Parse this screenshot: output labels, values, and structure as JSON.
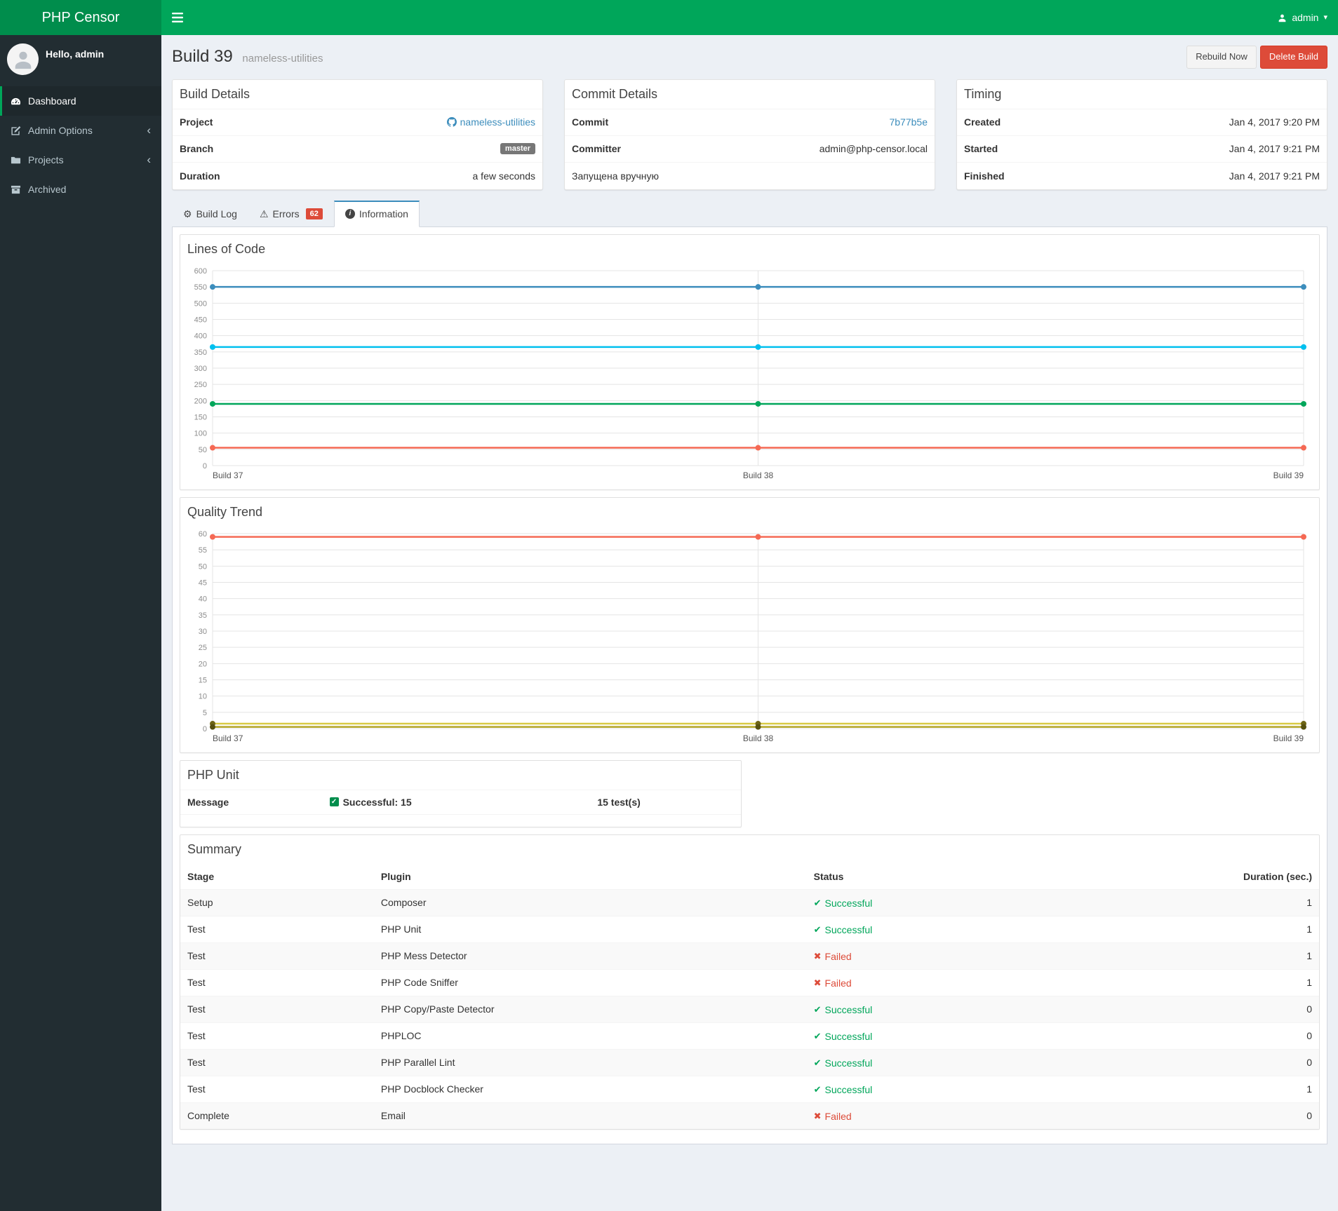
{
  "header": {
    "brand": "PHP Censor",
    "user": "admin"
  },
  "sidebar": {
    "greeting": "Hello, admin",
    "items": [
      {
        "label": "Dashboard"
      },
      {
        "label": "Admin Options"
      },
      {
        "label": "Projects"
      },
      {
        "label": "Archived"
      }
    ]
  },
  "page": {
    "title": "Build 39",
    "subtitle": "nameless-utilities",
    "rebuild_button": "Rebuild Now",
    "delete_button": "Delete Build"
  },
  "build_details": {
    "title": "Build Details",
    "project_label": "Project",
    "project_value": "nameless-utilities",
    "branch_label": "Branch",
    "branch_badge": "master",
    "duration_label": "Duration",
    "duration_value": "a few seconds"
  },
  "commit_details": {
    "title": "Commit Details",
    "commit_label": "Commit",
    "commit_value": "7b77b5e",
    "committer_label": "Committer",
    "committer_value": "admin@php-censor.local",
    "message": "Запущена вручную"
  },
  "timing": {
    "title": "Timing",
    "rows": [
      {
        "label": "Created",
        "value": "Jan 4, 2017 9:20 PM"
      },
      {
        "label": "Started",
        "value": "Jan 4, 2017 9:21 PM"
      },
      {
        "label": "Finished",
        "value": "Jan 4, 2017 9:21 PM"
      }
    ]
  },
  "tabs": {
    "build_log": "Build Log",
    "errors": "Errors",
    "errors_count": "62",
    "information": "Information"
  },
  "php_unit": {
    "title": "PHP Unit",
    "message_header": "Message",
    "status": "Successful: 15",
    "tests": "15 test(s)"
  },
  "summary": {
    "title": "Summary",
    "columns": [
      "Stage",
      "Plugin",
      "Status",
      "Duration (sec.)"
    ],
    "rows": [
      {
        "stage": "Setup",
        "plugin": "Composer",
        "status": "Successful",
        "success": true,
        "duration": "1"
      },
      {
        "stage": "Test",
        "plugin": "PHP Unit",
        "status": "Successful",
        "success": true,
        "duration": "1"
      },
      {
        "stage": "Test",
        "plugin": "PHP Mess Detector",
        "status": "Failed",
        "success": false,
        "duration": "1"
      },
      {
        "stage": "Test",
        "plugin": "PHP Code Sniffer",
        "status": "Failed",
        "success": false,
        "duration": "1"
      },
      {
        "stage": "Test",
        "plugin": "PHP Copy/Paste Detector",
        "status": "Successful",
        "success": true,
        "duration": "0"
      },
      {
        "stage": "Test",
        "plugin": "PHPLOC",
        "status": "Successful",
        "success": true,
        "duration": "0"
      },
      {
        "stage": "Test",
        "plugin": "PHP Parallel Lint",
        "status": "Successful",
        "success": true,
        "duration": "0"
      },
      {
        "stage": "Test",
        "plugin": "PHP Docblock Checker",
        "status": "Successful",
        "success": true,
        "duration": "1"
      },
      {
        "stage": "Complete",
        "plugin": "Email",
        "status": "Failed",
        "success": false,
        "duration": "0"
      }
    ]
  },
  "chart_data": [
    {
      "type": "line",
      "title": "Lines of Code",
      "x": [
        "Build 37",
        "Build 38",
        "Build 39"
      ],
      "series": [
        {
          "color": "#3c8dbc",
          "values": [
            550,
            550,
            550
          ]
        },
        {
          "color": "#00c0ef",
          "values": [
            365,
            365,
            365
          ]
        },
        {
          "color": "#00a65a",
          "values": [
            190,
            190,
            190
          ]
        },
        {
          "color": "#f56954",
          "values": [
            55,
            55,
            55
          ]
        }
      ],
      "ylim": [
        0,
        600
      ],
      "ytick": 50,
      "grid": true,
      "legend": "none"
    },
    {
      "type": "line",
      "title": "Quality Trend",
      "x": [
        "Build 37",
        "Build 38",
        "Build 39"
      ],
      "series": [
        {
          "color": "#f56954",
          "values": [
            59,
            59,
            59
          ]
        },
        {
          "color": "#d8ca43",
          "values": [
            1.5,
            1.5,
            1.5
          ],
          "point_color": "#6f6516"
        },
        {
          "color": "#b3a524",
          "values": [
            0.5,
            0.5,
            0.5
          ],
          "point_color": "#565010"
        }
      ],
      "ylim": [
        0,
        60
      ],
      "ytick": 5,
      "grid": true,
      "legend": "none"
    }
  ],
  "colors": {
    "brand_green": "#00a65a",
    "danger_red": "#dd4b39",
    "link_blue": "#3c8dbc",
    "success_green": "#00a65a"
  }
}
